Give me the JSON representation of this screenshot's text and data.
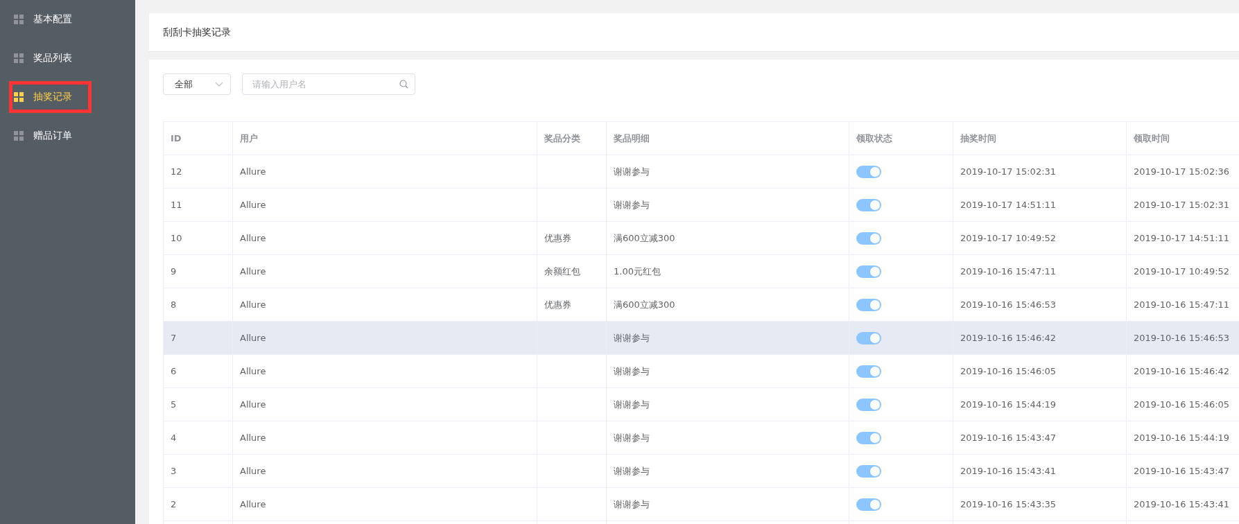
{
  "sidebar": {
    "items": [
      {
        "label": "基本配置",
        "selected": false
      },
      {
        "label": "奖品列表",
        "selected": false
      },
      {
        "label": "抽奖记录",
        "selected": true
      },
      {
        "label": "赠品订单",
        "selected": false
      }
    ]
  },
  "page": {
    "title": "刮刮卡抽奖记录"
  },
  "filter": {
    "select_value": "全部",
    "search": {
      "placeholder": "请输入用户名"
    }
  },
  "table": {
    "columns": [
      "ID",
      "用户",
      "奖品分类",
      "奖品明细",
      "领取状态",
      "抽奖时间",
      "领取时间"
    ],
    "rows": [
      {
        "id": "12",
        "user": "Allure",
        "category": "",
        "detail": "谢谢参与",
        "claimed": true,
        "draw_time": "2019-10-17 15:02:31",
        "claim_time": "2019-10-17 15:02:36",
        "highlighted": false
      },
      {
        "id": "11",
        "user": "Allure",
        "category": "",
        "detail": "谢谢参与",
        "claimed": true,
        "draw_time": "2019-10-17 14:51:11",
        "claim_time": "2019-10-17 15:02:31",
        "highlighted": false
      },
      {
        "id": "10",
        "user": "Allure",
        "category": "优惠券",
        "detail": "满600立减300",
        "claimed": true,
        "draw_time": "2019-10-17 10:49:52",
        "claim_time": "2019-10-17 14:51:11",
        "highlighted": false
      },
      {
        "id": "9",
        "user": "Allure",
        "category": "余额红包",
        "detail": "1.00元红包",
        "claimed": true,
        "draw_time": "2019-10-16 15:47:11",
        "claim_time": "2019-10-17 10:49:52",
        "highlighted": false
      },
      {
        "id": "8",
        "user": "Allure",
        "category": "优惠券",
        "detail": "满600立减300",
        "claimed": true,
        "draw_time": "2019-10-16 15:46:53",
        "claim_time": "2019-10-16 15:47:11",
        "highlighted": false
      },
      {
        "id": "7",
        "user": "Allure",
        "category": "",
        "detail": "谢谢参与",
        "claimed": true,
        "draw_time": "2019-10-16 15:46:42",
        "claim_time": "2019-10-16 15:46:53",
        "highlighted": true
      },
      {
        "id": "6",
        "user": "Allure",
        "category": "",
        "detail": "谢谢参与",
        "claimed": true,
        "draw_time": "2019-10-16 15:46:05",
        "claim_time": "2019-10-16 15:46:42",
        "highlighted": false
      },
      {
        "id": "5",
        "user": "Allure",
        "category": "",
        "detail": "谢谢参与",
        "claimed": true,
        "draw_time": "2019-10-16 15:44:19",
        "claim_time": "2019-10-16 15:46:05",
        "highlighted": false
      },
      {
        "id": "4",
        "user": "Allure",
        "category": "",
        "detail": "谢谢参与",
        "claimed": true,
        "draw_time": "2019-10-16 15:43:47",
        "claim_time": "2019-10-16 15:44:19",
        "highlighted": false
      },
      {
        "id": "3",
        "user": "Allure",
        "category": "",
        "detail": "谢谢参与",
        "claimed": true,
        "draw_time": "2019-10-16 15:43:41",
        "claim_time": "2019-10-16 15:43:47",
        "highlighted": false
      },
      {
        "id": "2",
        "user": "Allure",
        "category": "",
        "detail": "谢谢参与",
        "claimed": true,
        "draw_time": "2019-10-16 15:43:35",
        "claim_time": "2019-10-16 15:43:41",
        "highlighted": false
      }
    ]
  }
}
